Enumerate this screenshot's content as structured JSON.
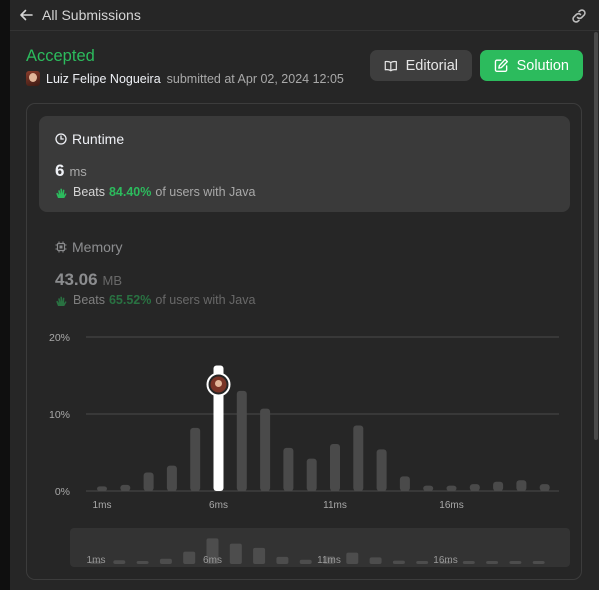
{
  "header": {
    "back_label": "All Submissions"
  },
  "submission": {
    "status": "Accepted",
    "author": "Luiz Felipe Nogueira",
    "submitted_text": "submitted at Apr 02, 2024 12:05"
  },
  "buttons": {
    "editorial": "Editorial",
    "solution": "Solution"
  },
  "runtime": {
    "title": "Runtime",
    "value": "6",
    "unit": "ms",
    "beats_label": "Beats",
    "beats_pct": "84.40%",
    "beats_suffix": "of users with Java"
  },
  "memory": {
    "title": "Memory",
    "value": "43.06",
    "unit": "MB",
    "beats_label": "Beats",
    "beats_pct": "65.52%",
    "beats_suffix": "of users with Java"
  },
  "colors": {
    "accent": "#2cbb5d",
    "bar": "#4a4a4a",
    "bar_highlight": "#ffffff"
  },
  "icons": {
    "back": "arrow-left-icon",
    "share": "link-icon",
    "editorial": "book-icon",
    "solution": "edit-icon",
    "runtime": "clock-icon",
    "memory": "chip-icon",
    "beats": "clap-icon"
  },
  "chart_data": {
    "type": "bar",
    "ylim": [
      0,
      20
    ],
    "ytick_labels": [
      "20%",
      "10%",
      "0%"
    ],
    "xtick_labels": [
      "1ms",
      "6ms",
      "11ms",
      "16ms"
    ],
    "highlight_index": 5,
    "values": [
      0.6,
      0.8,
      2.4,
      3.3,
      8.2,
      16.3,
      13.0,
      10.7,
      5.6,
      4.2,
      6.1,
      8.5,
      5.4,
      1.9,
      0.7,
      0.7,
      0.9,
      1.2,
      1.4,
      0.9
    ],
    "overview_values": [
      0.6,
      0.8,
      0.6,
      1.1,
      2.6,
      5.4,
      4.3,
      3.4,
      1.5,
      0.9,
      1.6,
      2.4,
      1.4,
      0.7,
      0.6,
      0.6,
      0.6,
      0.6,
      0.6,
      0.6
    ]
  }
}
